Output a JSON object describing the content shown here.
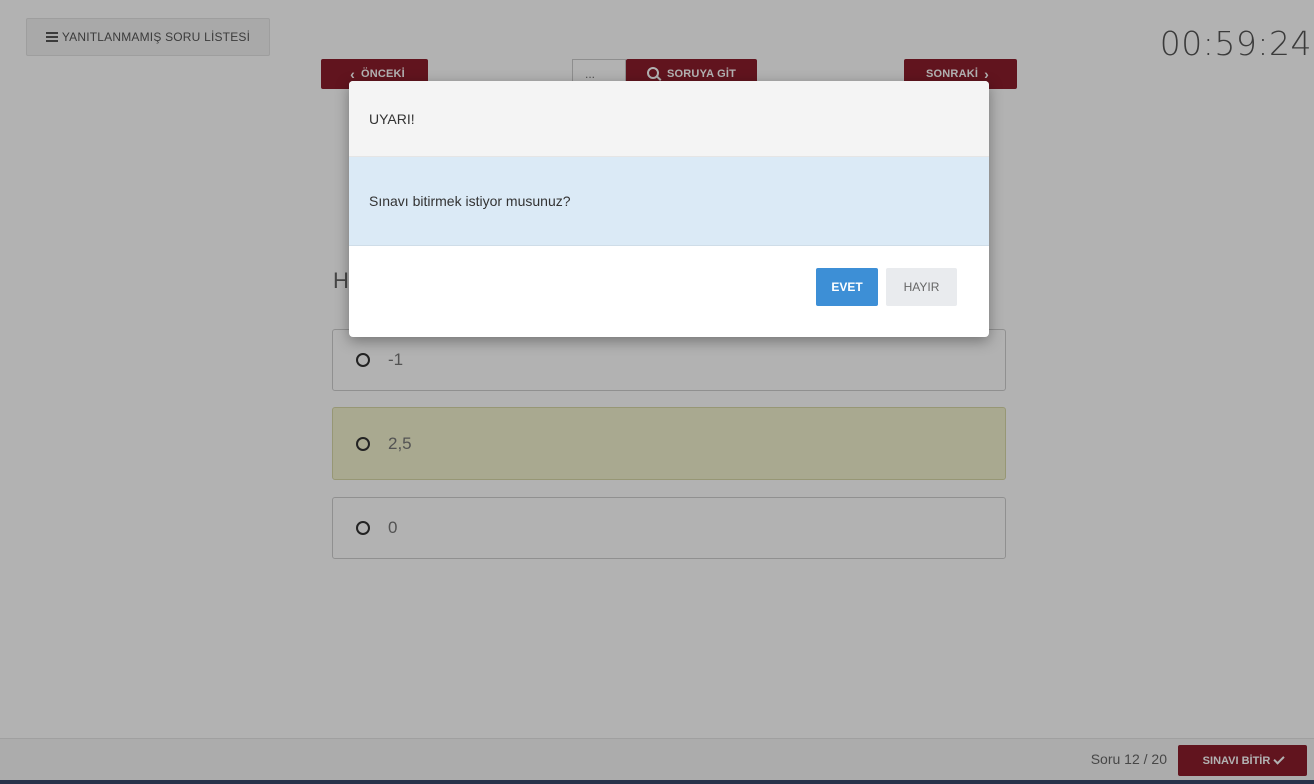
{
  "toolbar": {
    "unanswered_list_label": "YANITLANMAMIŞ SORU LİSTESİ",
    "timer": "00:59:24",
    "prev_label": "ÖNCEKİ",
    "goto_placeholder": "...",
    "goto_label": "SORUYA GİT",
    "next_label": "SONRAKİ"
  },
  "question": {
    "text_visible": "H",
    "options": [
      {
        "label": "-1",
        "selected": false
      },
      {
        "label": "2,5",
        "selected": true
      },
      {
        "label": "0",
        "selected": false
      }
    ]
  },
  "footer": {
    "counter": "Soru 12 / 20",
    "finish_label": "SINAVI BİTİR"
  },
  "modal": {
    "title": "UYARI!",
    "message": "Sınavı bitirmek istiyor musunuz?",
    "yes_label": "EVET",
    "no_label": "HAYIR"
  },
  "colors": {
    "brand": "#8b1e2c",
    "primary": "#3d8fd6",
    "selected_option": "#f3f3cf",
    "info_bg": "#dbeaf6"
  }
}
